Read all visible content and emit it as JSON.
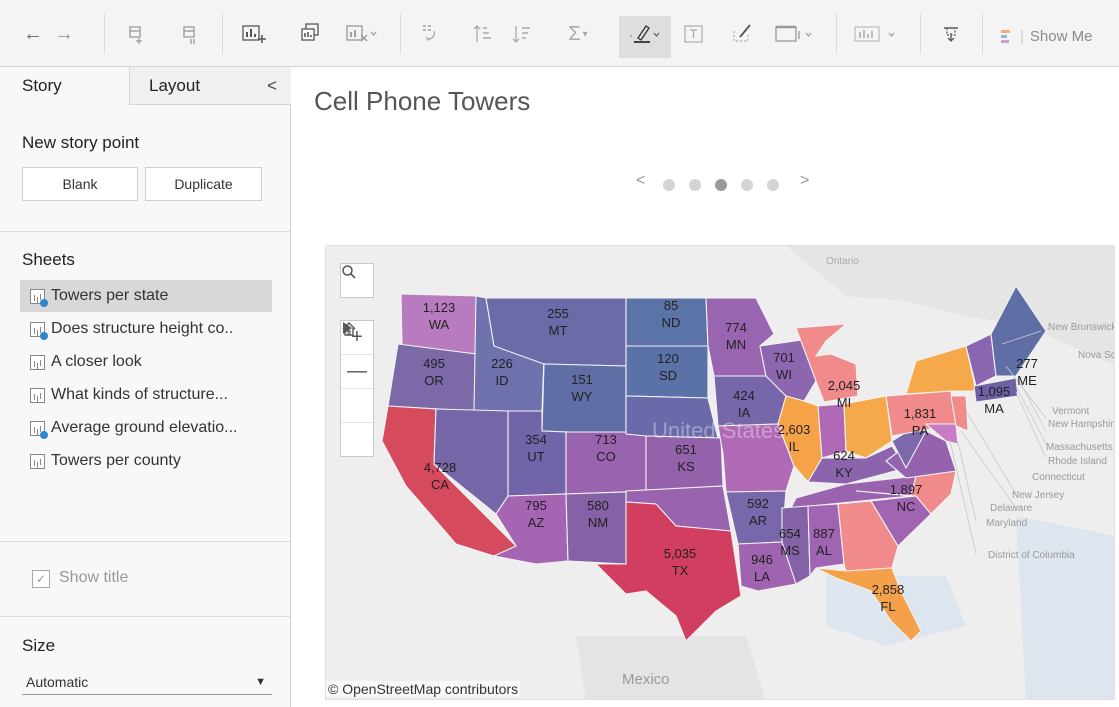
{
  "toolbar": {
    "show_me_label": "Show Me",
    "icons": [
      "back-icon",
      "forward-icon",
      "new-data-source-icon",
      "pause-updates-icon",
      "new-worksheet-icon",
      "duplicate-sheet-icon",
      "clear-sheet-icon",
      "swap-rows-columns-icon",
      "sort-ascending-icon",
      "sort-descending-icon",
      "totals-icon",
      "highlight-icon",
      "labels-icon",
      "annotate-icon",
      "fit-icon",
      "show-cards-icon",
      "present-icon",
      "show-me-icon"
    ]
  },
  "panel": {
    "tabs": {
      "story": "Story",
      "layout": "Layout",
      "collapse": "<"
    },
    "new_story_point": {
      "title": "New story point",
      "blank": "Blank",
      "duplicate": "Duplicate"
    },
    "sheets": {
      "title": "Sheets",
      "items": [
        {
          "label": "Towers per state",
          "badge": true,
          "selected": true
        },
        {
          "label": "Does structure height co..",
          "badge": true,
          "selected": false
        },
        {
          "label": "A closer look",
          "badge": false,
          "selected": false
        },
        {
          "label": "What kinds of structure...",
          "badge": false,
          "selected": false
        },
        {
          "label": "Average ground elevatio...",
          "badge": true,
          "selected": false
        },
        {
          "label": "Towers per county",
          "badge": false,
          "selected": false
        }
      ]
    },
    "show_title": {
      "label": "Show title",
      "checked": true,
      "check_glyph": "✓"
    },
    "size": {
      "title": "Size",
      "value": "Automatic"
    }
  },
  "story": {
    "title": "Cell Phone Towers",
    "nav": {
      "prev": "<",
      "next": ">",
      "points": 5,
      "active_index": 2
    }
  },
  "map": {
    "attribution": "© OpenStreetMap contributors",
    "base_labels": {
      "ontario": "Ontario",
      "mexico": "Mexico",
      "united_states": "United States"
    },
    "colors": {
      "low": "#6a86b0",
      "mid": "#8a67a8",
      "high": "#f08a8a",
      "top": "#d93d5a",
      "orange": "#f5a94a"
    },
    "state_values": [
      {
        "state": "WA",
        "value": "1,123"
      },
      {
        "state": "MT",
        "value": "255"
      },
      {
        "state": "ND",
        "value": "85"
      },
      {
        "state": "MN",
        "value": "774"
      },
      {
        "state": "OR",
        "value": "495"
      },
      {
        "state": "ID",
        "value": "226"
      },
      {
        "state": "SD",
        "value": "120"
      },
      {
        "state": "WY",
        "value": "151"
      },
      {
        "state": "WI",
        "value": "701"
      },
      {
        "state": "MI",
        "value": "2,045"
      },
      {
        "state": "IA",
        "value": "424"
      },
      {
        "state": "IL",
        "value": "2,603"
      },
      {
        "state": "PA",
        "value": "1,831"
      },
      {
        "state": "MA",
        "value": "1,095"
      },
      {
        "state": "ME",
        "value": "277"
      },
      {
        "state": "CA",
        "value": "4,728"
      },
      {
        "state": "UT",
        "value": "354"
      },
      {
        "state": "CO",
        "value": "713"
      },
      {
        "state": "KS",
        "value": "651"
      },
      {
        "state": "KY",
        "value": "624"
      },
      {
        "state": "NC",
        "value": "1,897"
      },
      {
        "state": "AZ",
        "value": "795"
      },
      {
        "state": "NM",
        "value": "580"
      },
      {
        "state": "AR",
        "value": "592"
      },
      {
        "state": "MS",
        "value": "654"
      },
      {
        "state": "AL",
        "value": "887"
      },
      {
        "state": "TX",
        "value": "5,035"
      },
      {
        "state": "LA",
        "value": "946"
      },
      {
        "state": "FL",
        "value": "2,858"
      }
    ],
    "callouts": [
      "New Brunswick",
      "Nova Scotia",
      "Vermont",
      "New Hampshire",
      "Massachusetts",
      "Rhode Island",
      "Connecticut",
      "New Jersey",
      "Delaware",
      "Maryland",
      "District of Columbia"
    ]
  }
}
